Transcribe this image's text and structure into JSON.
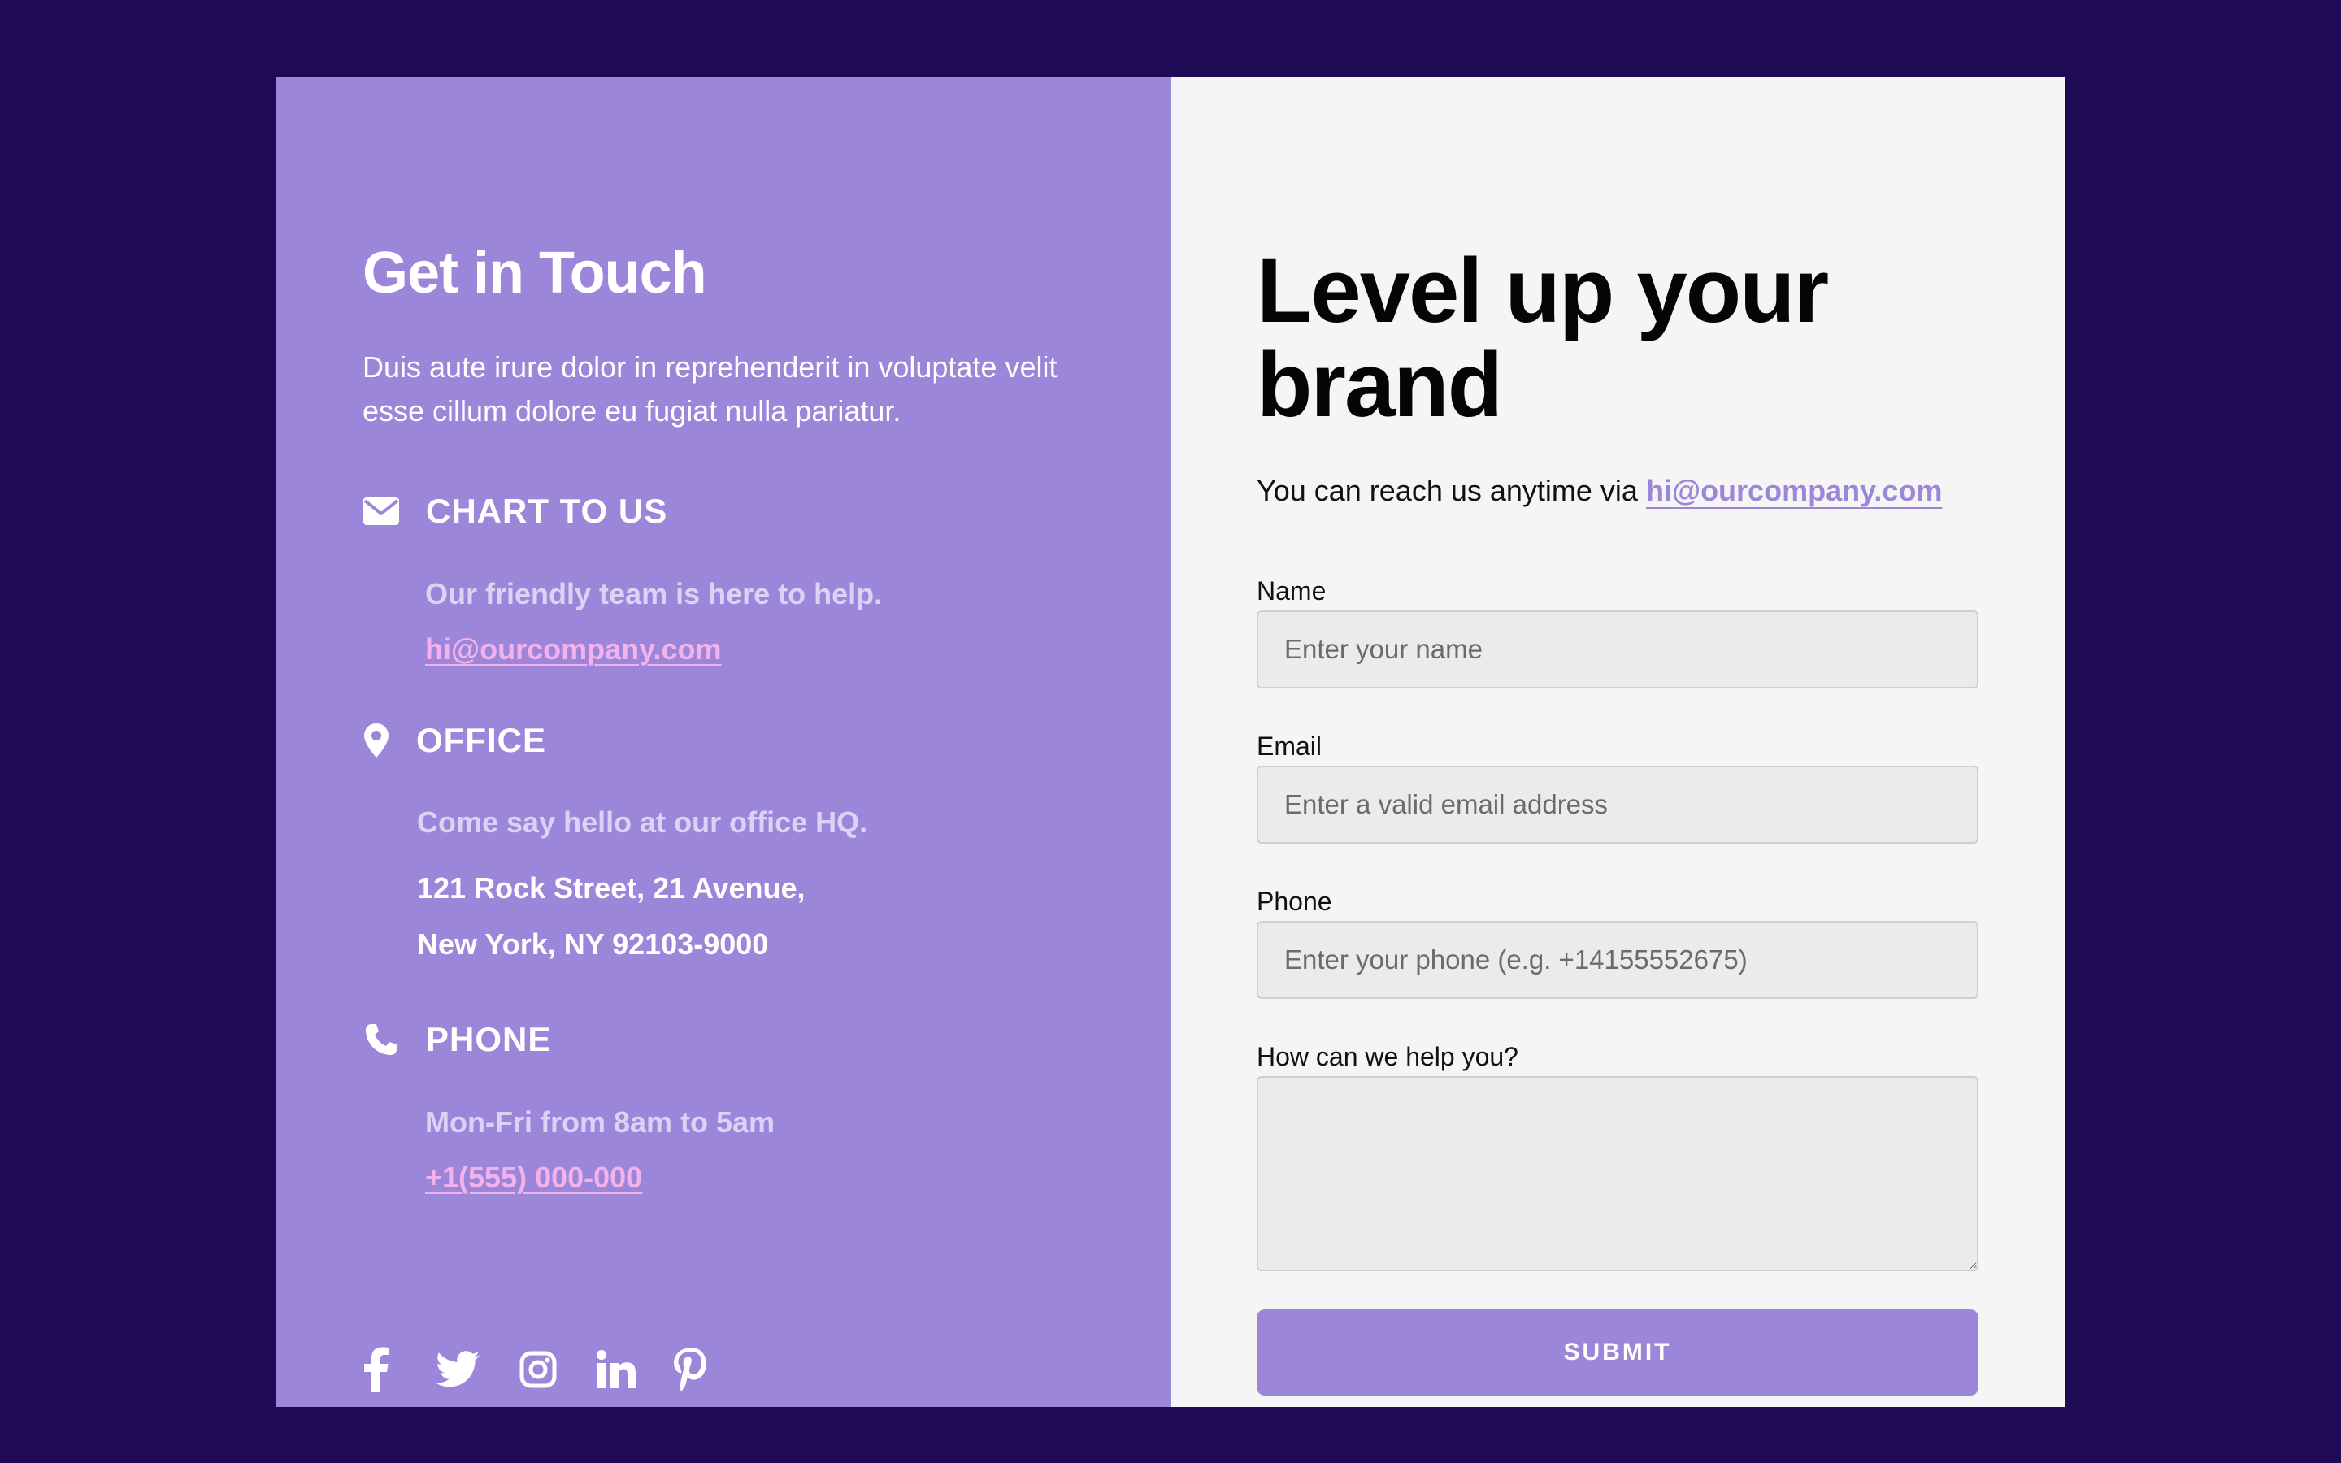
{
  "contact_info": {
    "title": "Get in Touch",
    "description": "Duis aute irure dolor in reprehenderit in voluptate velit esse cillum dolore eu fugiat nulla pariatur.",
    "chat": {
      "icon": "envelope-icon",
      "title": "CHART TO US",
      "subtitle": "Our friendly team is here to help.",
      "email": "hi@ourcompany.com"
    },
    "office": {
      "icon": "map-pin-icon",
      "title": "OFFICE",
      "subtitle": "Come say hello at our office HQ.",
      "address_line1": "121 Rock Street, 21 Avenue,",
      "address_line2": "New York, NY 92103-9000"
    },
    "phone": {
      "icon": "phone-icon",
      "title": "PHONE",
      "subtitle": "Mon-Fri from 8am to 5am",
      "number": "+1(555) 000-000"
    },
    "social": [
      "facebook-icon",
      "twitter-icon",
      "instagram-icon",
      "linkedin-icon",
      "pinterest-icon"
    ]
  },
  "form": {
    "title": "Level up your brand",
    "reach_text": "You can reach us anytime via",
    "reach_email": "hi@ourcompany.com",
    "fields": {
      "name": {
        "label": "Name",
        "placeholder": "Enter your name"
      },
      "email": {
        "label": "Email",
        "placeholder": "Enter a valid email address"
      },
      "phone": {
        "label": "Phone",
        "placeholder": "Enter your phone (e.g. +14155552675)"
      },
      "message": {
        "label": "How can we help you?",
        "placeholder": ""
      }
    },
    "submit_label": "SUBMIT"
  },
  "colors": {
    "page_background": "#1f0a55",
    "panel_accent": "#9c86da",
    "form_background": "#f5f5f5",
    "link_pink": "#f4b2ec"
  }
}
